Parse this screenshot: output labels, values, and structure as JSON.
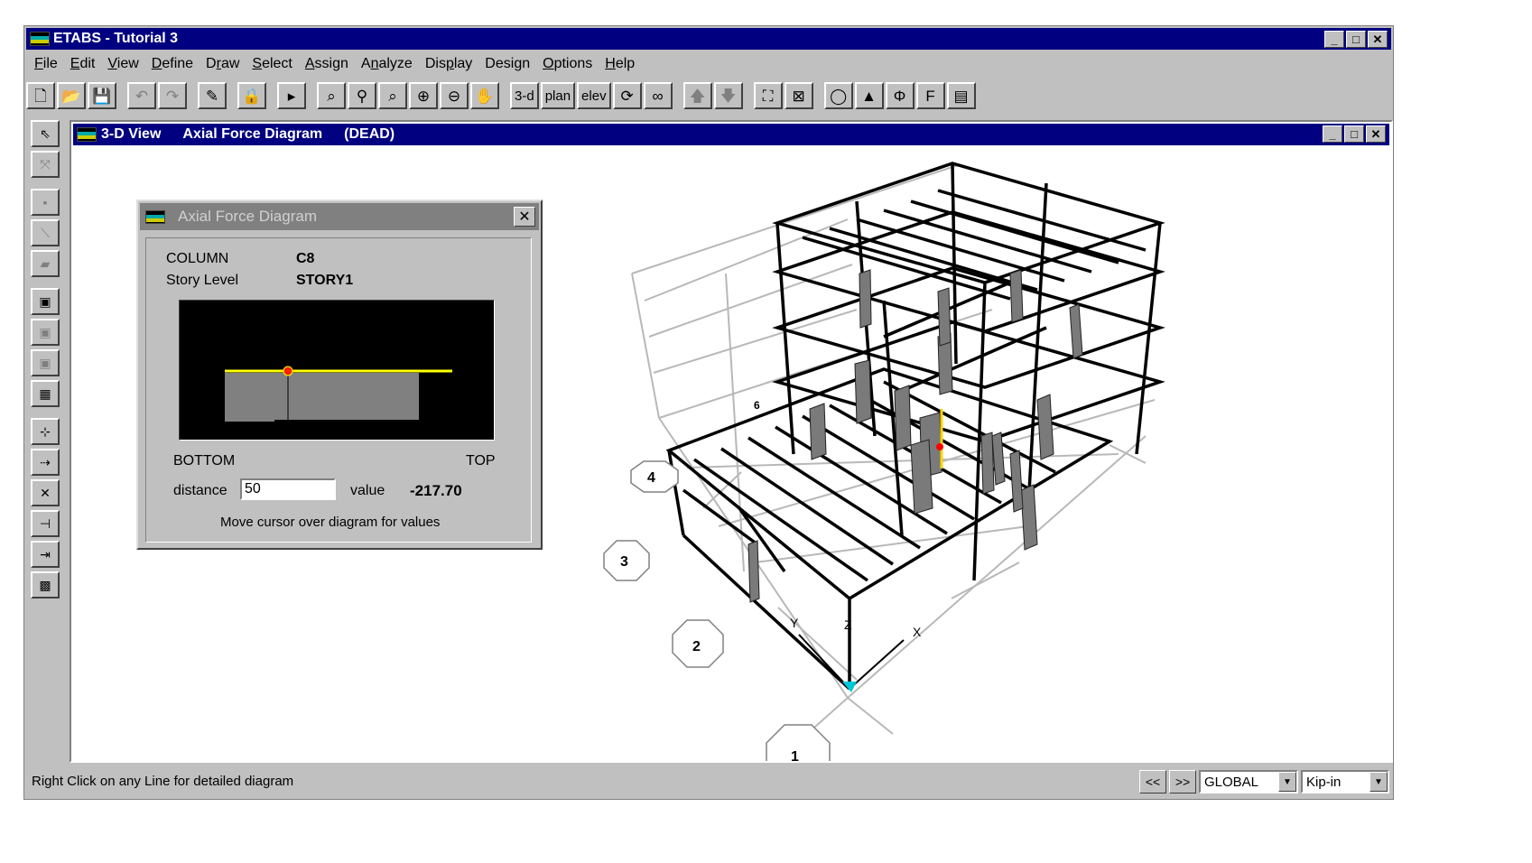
{
  "app": {
    "title": "ETABS - Tutorial 3",
    "window_buttons": {
      "minimize": "_",
      "maximize": "□",
      "close": "✕"
    }
  },
  "menu": [
    {
      "pre": "",
      "u": "F",
      "post": "ile"
    },
    {
      "pre": "",
      "u": "E",
      "post": "dit"
    },
    {
      "pre": "",
      "u": "V",
      "post": "iew"
    },
    {
      "pre": "",
      "u": "D",
      "post": "efine"
    },
    {
      "pre": "D",
      "u": "r",
      "post": "aw"
    },
    {
      "pre": "",
      "u": "S",
      "post": "elect"
    },
    {
      "pre": "",
      "u": "A",
      "post": "ssign"
    },
    {
      "pre": "A",
      "u": "n",
      "post": "alyze"
    },
    {
      "pre": "Dis",
      "u": "p",
      "post": "lay"
    },
    {
      "pre": "Desi",
      "u": "g",
      "post": "n"
    },
    {
      "pre": "",
      "u": "O",
      "post": "ptions"
    },
    {
      "pre": "",
      "u": "H",
      "post": "elp"
    }
  ],
  "toolbar": {
    "view_3d": "3-d",
    "view_plan": "plan",
    "view_elev": "elev"
  },
  "child_window": {
    "title_1": "3-D View",
    "title_2": "Axial Force Diagram",
    "title_3": "(DEAD)"
  },
  "dialog": {
    "title": "Axial Force Diagram",
    "column_label": "COLUMN",
    "column_value": "C8",
    "story_label": "Story Level",
    "story_value": "STORY1",
    "bottom_label": "BOTTOM",
    "top_label": "TOP",
    "distance_label": "distance",
    "distance_value": "50",
    "value_label": "value",
    "value_value": "-217.70",
    "hint": "Move cursor over diagram for values",
    "close": "✕"
  },
  "grid_bubbles": [
    "1",
    "2",
    "3",
    "4",
    "6"
  ],
  "axis_labels": {
    "x": "X",
    "y": "Y",
    "z": "Z"
  },
  "status": {
    "message": "Right Click on any Line for detailed diagram",
    "prev": "<<",
    "next": ">>",
    "coord_system": "GLOBAL",
    "units": "Kip-in"
  }
}
